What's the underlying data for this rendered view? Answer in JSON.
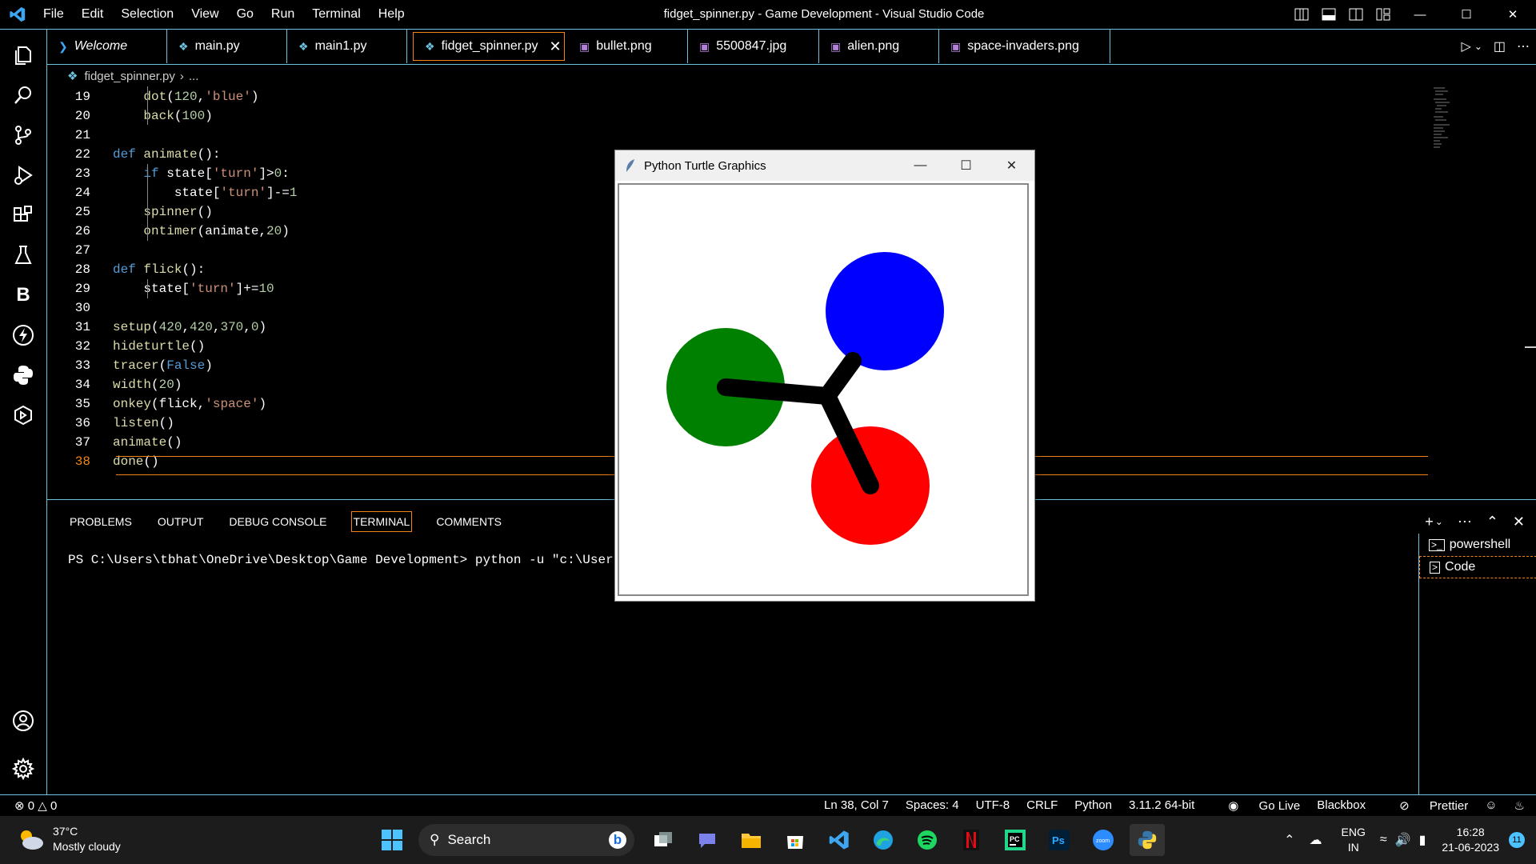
{
  "window": {
    "title": "fidget_spinner.py - Game Development - Visual Studio Code",
    "menu": [
      "File",
      "Edit",
      "Selection",
      "View",
      "Go",
      "Run",
      "Terminal",
      "Help"
    ]
  },
  "tabs": [
    {
      "label": "Welcome",
      "icon": "vscode-icon"
    },
    {
      "label": "main.py",
      "icon": "python-icon"
    },
    {
      "label": "main1.py",
      "icon": "python-icon"
    },
    {
      "label": "fidget_spinner.py",
      "icon": "python-icon",
      "active": true
    },
    {
      "label": "bullet.png",
      "icon": "image-icon"
    },
    {
      "label": "5500847.jpg",
      "icon": "image-icon"
    },
    {
      "label": "alien.png",
      "icon": "image-icon"
    },
    {
      "label": "space-invaders.png",
      "icon": "image-icon"
    }
  ],
  "breadcrumb": {
    "file": "fidget_spinner.py",
    "rest": "..."
  },
  "code": {
    "lines": [
      {
        "n": "19",
        "text": "dot(120,'blue')"
      },
      {
        "n": "20",
        "text": "back(100)"
      },
      {
        "n": "21",
        "text": ""
      },
      {
        "n": "22",
        "text": "def animate():"
      },
      {
        "n": "23",
        "text": "if state['turn']>0:"
      },
      {
        "n": "24",
        "text": "state['turn']-=1"
      },
      {
        "n": "25",
        "text": "spinner()"
      },
      {
        "n": "26",
        "text": "ontimer(animate,20)"
      },
      {
        "n": "27",
        "text": ""
      },
      {
        "n": "28",
        "text": "def flick():"
      },
      {
        "n": "29",
        "text": "state['turn']+=10"
      },
      {
        "n": "30",
        "text": ""
      },
      {
        "n": "31",
        "text": "setup(420,420,370,0)"
      },
      {
        "n": "32",
        "text": "hideturtle()"
      },
      {
        "n": "33",
        "text": "tracer(False)"
      },
      {
        "n": "34",
        "text": "width(20)"
      },
      {
        "n": "35",
        "text": "onkey(flick,'space')"
      },
      {
        "n": "36",
        "text": "listen()"
      },
      {
        "n": "37",
        "text": "animate()"
      },
      {
        "n": "38",
        "text": "done()"
      }
    ]
  },
  "panel": {
    "tabs": [
      "PROBLEMS",
      "OUTPUT",
      "DEBUG CONSOLE",
      "TERMINAL",
      "COMMENTS"
    ],
    "active_tab": "TERMINAL",
    "terminal_line": "PS C:\\Users\\tbhat\\OneDrive\\Desktop\\Game Development> python -u \"c:\\Users\\tbh",
    "terminals": [
      "powershell",
      "Code"
    ]
  },
  "status": {
    "errors": "0",
    "warnings": "0",
    "items": [
      "Ln 38, Col 7",
      "Spaces: 4",
      "UTF-8",
      "CRLF",
      "Python",
      "3.11.2 64-bit",
      "Go Live",
      "Blackbox",
      "Prettier"
    ]
  },
  "turtle_window": {
    "title": "Python Turtle Graphics",
    "colors": {
      "blue": "#0000ff",
      "green": "#008000",
      "red": "#ff0000",
      "arm": "#000000"
    }
  },
  "taskbar": {
    "weather_temp": "37°C",
    "weather_desc": "Mostly cloudy",
    "search_label": "Search",
    "lang_top": "ENG",
    "lang_bottom": "IN",
    "time": "16:28",
    "date": "21-06-2023",
    "notifications": "11"
  },
  "accent": "#6fc3df",
  "highlight": "#f38518"
}
